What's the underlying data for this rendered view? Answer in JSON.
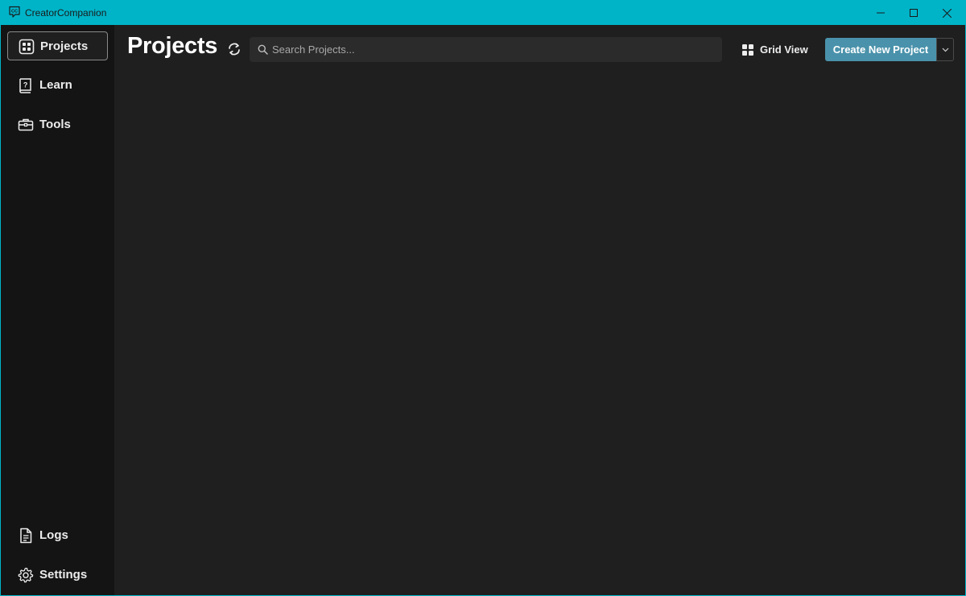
{
  "window": {
    "title": "CreatorCompanion",
    "accent_color": "#00b4c8"
  },
  "sidebar": {
    "items": [
      {
        "label": "Projects",
        "icon": "grid-box-icon",
        "active": true
      },
      {
        "label": "Learn",
        "icon": "question-book-icon",
        "active": false
      },
      {
        "label": "Tools",
        "icon": "toolbox-icon",
        "active": false
      }
    ],
    "bottom_items": [
      {
        "label": "Logs",
        "icon": "document-icon"
      },
      {
        "label": "Settings",
        "icon": "gear-icon"
      }
    ]
  },
  "header": {
    "title": "Projects",
    "search_placeholder": "Search Projects...",
    "view_mode_label": "Grid View",
    "create_label": "Create New Project",
    "create_color": "#4a92ab"
  }
}
